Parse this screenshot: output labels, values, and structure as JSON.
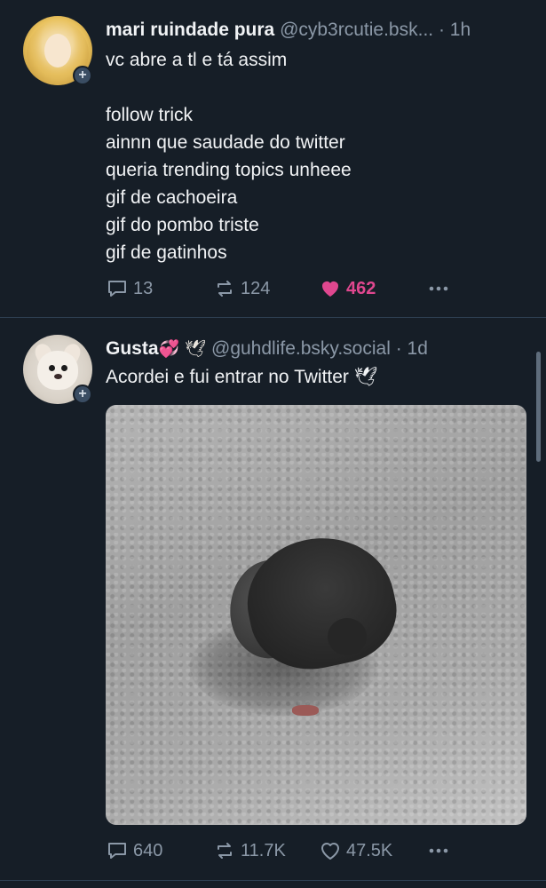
{
  "posts": [
    {
      "author": {
        "display_name": "mari ruindade pura",
        "handle": "@cyb3rcutie.bsk...",
        "time": "· 1h",
        "avatar_badge": "+"
      },
      "text": "vc abre a tl e tá assim\n\nfollow trick\nainnn que saudade do twitter\nqueria trending topics unheee\ngif de cachoeira\ngif do pombo triste\ngif de gatinhos",
      "counts": {
        "replies": "13",
        "reposts": "124",
        "likes": "462"
      },
      "liked": true
    },
    {
      "author": {
        "display_name": "Gusta",
        "name_emojis": [
          "💞",
          "🕊"
        ],
        "handle": "@guhdlife.bsky.social",
        "time": "· 1d",
        "avatar_badge": "+"
      },
      "text": "Acordei e fui entrar no Twitter 🕊",
      "media": {
        "type": "gif",
        "subject": "pigeon pecking the ground"
      },
      "counts": {
        "replies": "640",
        "reposts": "11.7K",
        "likes": "47.5K"
      },
      "liked": false
    }
  ],
  "icons": {
    "reply": "reply-icon",
    "repost": "repost-icon",
    "like": "heart-icon",
    "more": "more-icon"
  },
  "colors": {
    "background": "#161e27",
    "text": "#f1f3f5",
    "muted": "#8b98a7",
    "like_active": "#e0478f",
    "divider": "#2e4052"
  }
}
